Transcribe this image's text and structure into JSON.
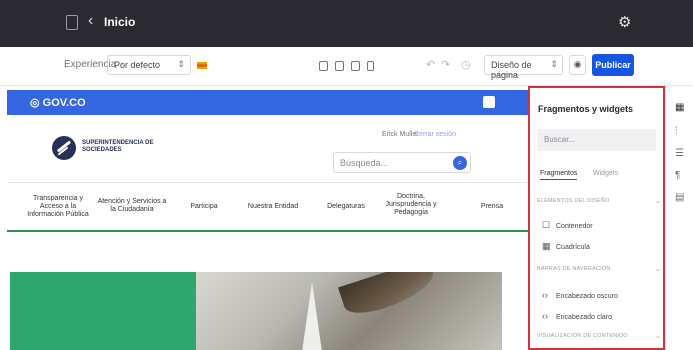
{
  "topbar": {
    "back_glyph": "‹",
    "title": "Inicio",
    "settings_icon": "gear-icon"
  },
  "toolbar": {
    "experience_label": "Experiencia",
    "experience_value": "Por defecto",
    "layout_value": "Diseño de página",
    "preview_icon": "eye-icon",
    "publish_label": "Publicar",
    "history_glyphs": [
      "↶",
      "↷",
      "◷"
    ]
  },
  "canvas": {
    "gov_logo": "GOV.CO",
    "brand_name": "SUPERINTENDENCIA DE SOCIEDADES",
    "user_name": "Erick Muller",
    "signout_label": "Cerrar sesión",
    "search_placeholder": "Búsqueda...",
    "nav": [
      {
        "label": "Transparencia y Acceso a la Información Pública"
      },
      {
        "label": "Atención y Servicios a la Ciudadanía"
      },
      {
        "label": "Participa"
      },
      {
        "label": "Nuestra Entidad"
      },
      {
        "label": "Delegaturas"
      },
      {
        "label": "Doctrina, Jurisprudencia y Pedagogía"
      },
      {
        "label": "Prensa"
      }
    ]
  },
  "panel": {
    "title": "Fragmentos y widgets",
    "search_placeholder": "Buscar...",
    "tabs": [
      {
        "label": "Fragmentos",
        "active": true
      },
      {
        "label": "Widgets",
        "active": false
      }
    ],
    "sections": [
      {
        "label": "ELEMENTOS DEL DISEÑO",
        "items": [
          {
            "label": "Contenedor",
            "icon": "container-icon"
          },
          {
            "label": "Cuadrícula",
            "icon": "grid-icon"
          }
        ]
      },
      {
        "label": "BARRAS DE NAVEGACIÓN",
        "items": [
          {
            "label": "Encabezado oscuro",
            "icon": "code-icon"
          },
          {
            "label": "Encabezado claro",
            "icon": "code-icon"
          }
        ]
      },
      {
        "label": "VISUALIZACIÓN DE CONTENIDO",
        "items": []
      }
    ]
  },
  "colors": {
    "topbar": "#2a2a30",
    "accent_blue": "#1556e0",
    "gov_blue": "#3366e0",
    "panel_border": "#d0343c",
    "green": "#2fa66e"
  }
}
